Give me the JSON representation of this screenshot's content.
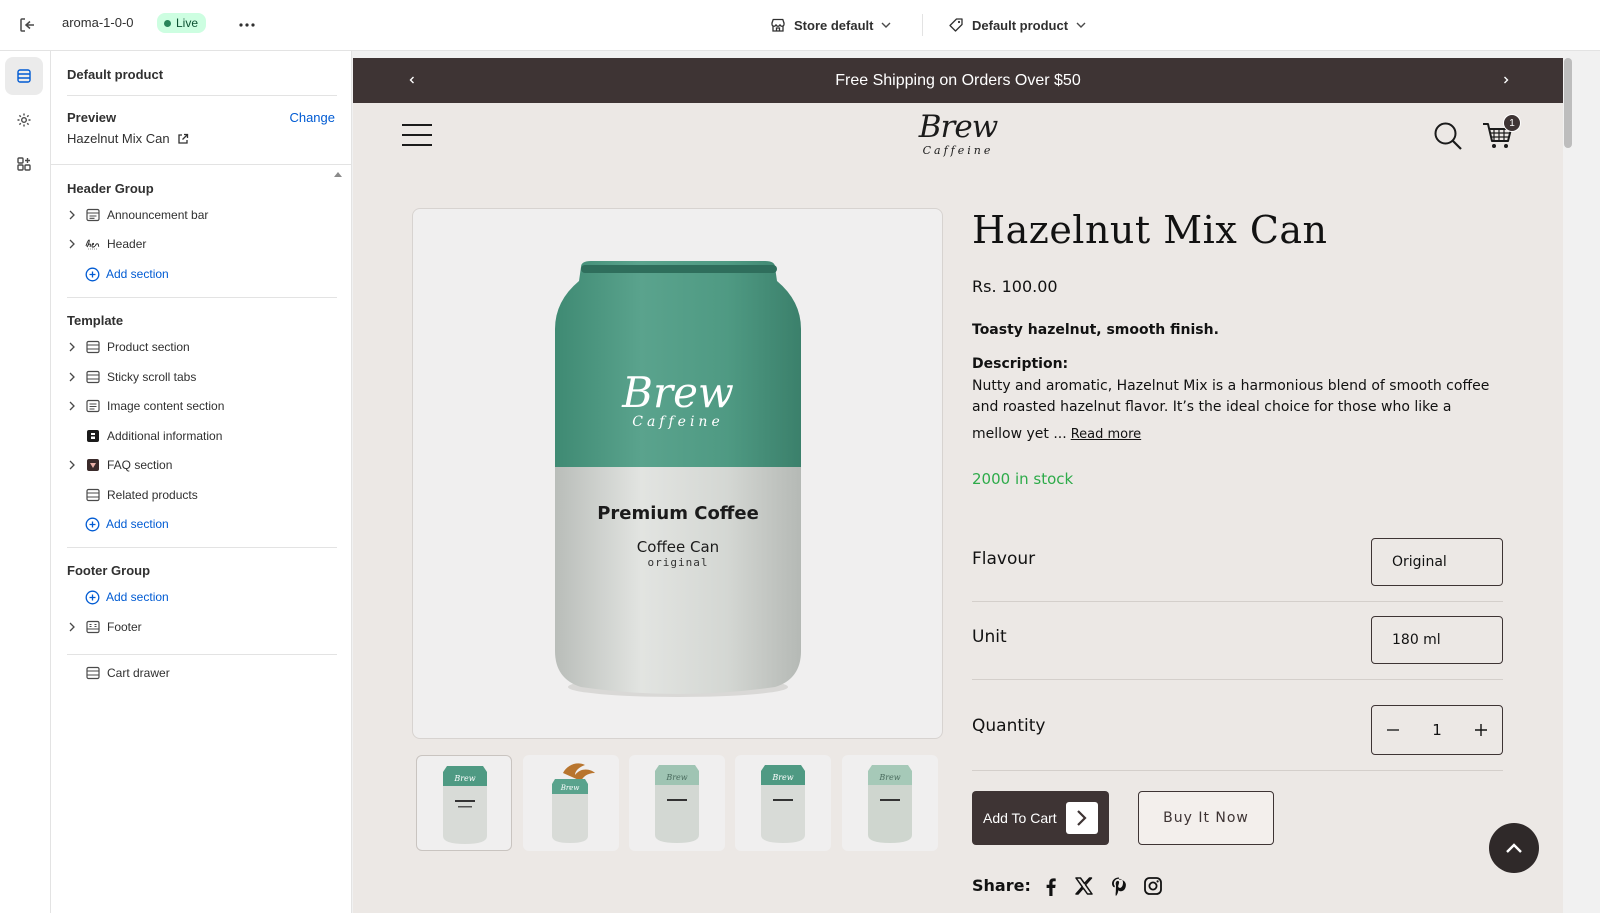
{
  "topbar": {
    "theme_name": "aroma-1-0-0",
    "live_label": "Live",
    "store_select": "Store default",
    "product_select": "Default product"
  },
  "sidebar": {
    "title": "Default product",
    "preview_label": "Preview",
    "change_label": "Change",
    "preview_value": "Hazelnut Mix Can",
    "groups": [
      {
        "heading": "Header Group",
        "items": [
          {
            "label": "Announcement bar"
          },
          {
            "label": "Header"
          }
        ],
        "add_label": "Add section"
      },
      {
        "heading": "Template",
        "items": [
          {
            "label": "Product section"
          },
          {
            "label": "Sticky scroll tabs"
          },
          {
            "label": "Image content section"
          },
          {
            "label": "Additional information"
          },
          {
            "label": "FAQ section"
          },
          {
            "label": "Related products"
          }
        ],
        "add_label": "Add section"
      },
      {
        "heading": "Footer Group",
        "add_label": "Add section",
        "items": [
          {
            "label": "Footer"
          }
        ]
      }
    ],
    "cart_drawer": "Cart drawer"
  },
  "store": {
    "announcement": "Free Shipping on Orders Over $50",
    "logo_main": "Brew",
    "logo_sub": "Caffeine",
    "cart_count": "1",
    "can": {
      "brand": "Brew",
      "brand_sub": "Caffeine",
      "line1": "Premium Coffee",
      "line2": "Coffee Can",
      "line3": "original"
    },
    "product": {
      "title": "Hazelnut Mix Can",
      "price": "Rs. 100.00",
      "tagline": "Toasty hazelnut, smooth finish.",
      "desc_label": "Description:",
      "desc": "Nutty and aromatic, Hazelnut Mix is a harmonious blend of smooth coffee and roasted hazelnut flavor. It’s the ideal choice for those who like a",
      "desc_tail": "mellow yet ...",
      "read_more": "Read more",
      "stock": "2000 in stock",
      "flavour_label": "Flavour",
      "flavour_value": "Original",
      "unit_label": "Unit",
      "unit_value": "180 ml",
      "quantity_label": "Quantity",
      "quantity_value": "1",
      "add_to_cart": "Add To Cart",
      "buy_now": "Buy It Now",
      "share_label": "Share:"
    }
  },
  "colors": {
    "announcement_bg": "#3e3434",
    "can_green": "#4f9a83",
    "stock_green": "#2eab4a",
    "link_blue": "#005bd3"
  }
}
